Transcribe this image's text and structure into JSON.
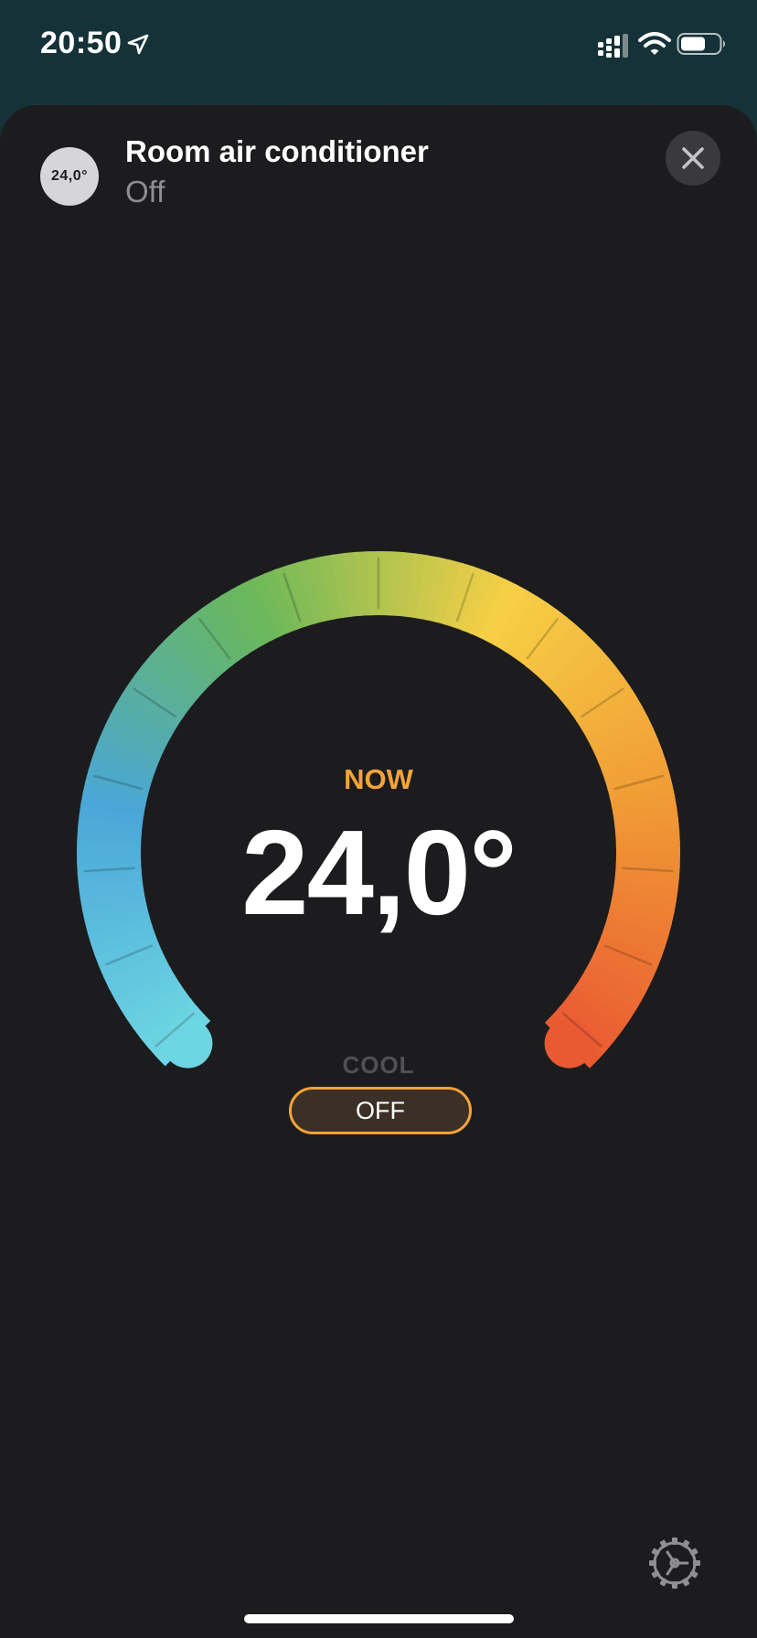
{
  "status_bar": {
    "time": "20:50"
  },
  "header": {
    "badge": "24,0°",
    "title": "Room air conditioner",
    "status": "Off"
  },
  "thermostat": {
    "label": "NOW",
    "temperature": "24,0°",
    "mode": "COOL",
    "power_label": "OFF"
  },
  "icons": {
    "location": "location-arrow-icon",
    "signal": "cellular-signal-icon",
    "wifi": "wifi-icon",
    "battery": "battery-icon",
    "close": "close-icon",
    "settings": "gear-icon"
  },
  "colors": {
    "accent": "#f2a33a",
    "background": "#1c1c1e",
    "dial_gradient": [
      "#6ed6e2",
      "#4aa6d8",
      "#6ab85a",
      "#f7cf45",
      "#f09a35",
      "#ea5a32"
    ]
  }
}
